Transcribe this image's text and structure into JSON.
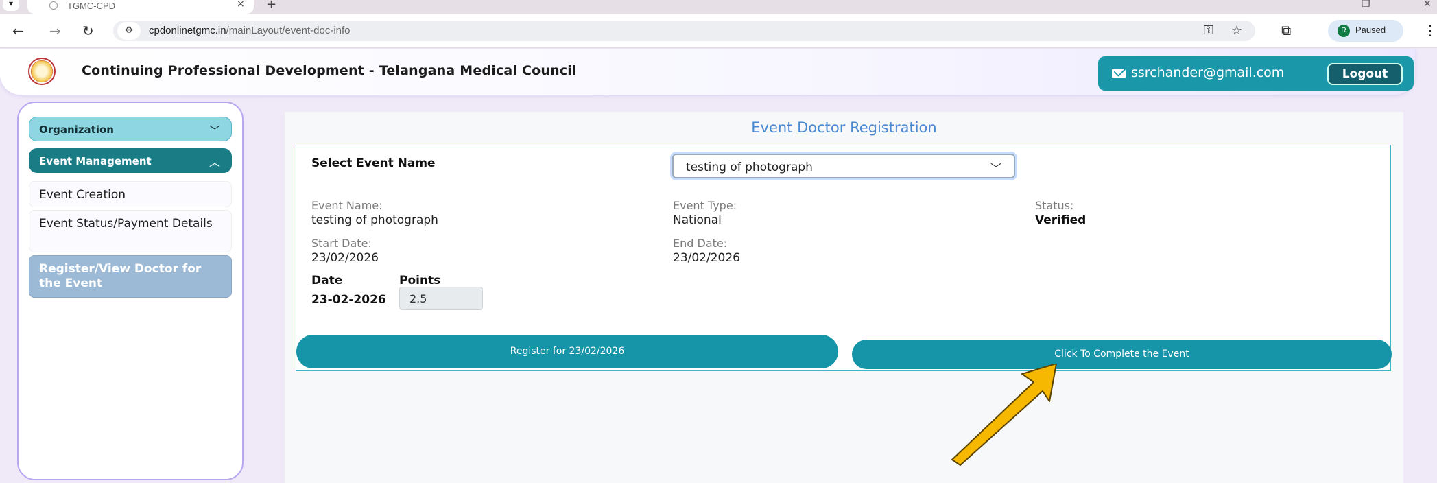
{
  "browser": {
    "tab_title": "TGMC-CPD",
    "tab_close": "×",
    "new_tab": "+",
    "url_host": "cpdonlinetgmc.in",
    "url_path": "/mainLayout/event-doc-info",
    "profile_initial": "R",
    "profile_status": "Paused"
  },
  "header": {
    "title": "Continuing Professional Development - Telangana Medical Council",
    "user_email": "ssrchander@gmail.com",
    "logout_label": "Logout"
  },
  "sidebar": {
    "groups": [
      {
        "label": "Organization",
        "expanded": false
      },
      {
        "label": "Event Management",
        "expanded": true
      }
    ],
    "items": [
      {
        "label": "Event Creation"
      },
      {
        "label": "Event Status/Payment Details"
      },
      {
        "label": "Register/View Doctor for the Event",
        "active": true
      }
    ]
  },
  "main": {
    "title": "Event Doctor Registration",
    "select_label": "Select Event Name",
    "select_value": "testing of photograph",
    "fields": {
      "event_name_label": "Event Name:",
      "event_name_value": "testing of photograph",
      "event_type_label": "Event Type:",
      "event_type_value": "National",
      "status_label": "Status:",
      "status_value": "Verified",
      "start_date_label": "Start Date:",
      "start_date_value": "23/02/2026",
      "end_date_label": "End Date:",
      "end_date_value": "23/02/2026"
    },
    "points_table": {
      "headers": [
        "Date",
        "Points"
      ],
      "rows": [
        {
          "date": "23-02-2026",
          "points": "2.5"
        }
      ]
    },
    "register_button": "Register for 23/02/2026",
    "complete_button": "Click To Complete the Event"
  },
  "colors": {
    "accent_teal": "#1695a8",
    "arrow_fill": "#f6b800",
    "title_blue": "#4a88d0"
  }
}
